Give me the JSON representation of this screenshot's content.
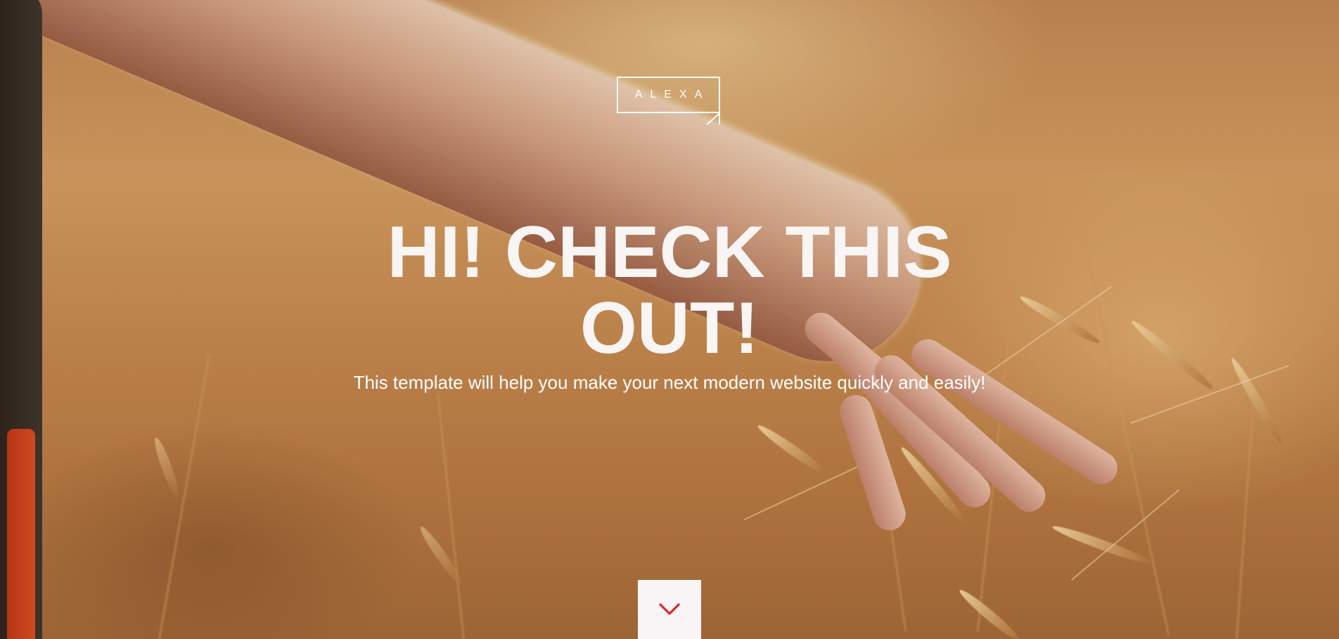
{
  "hero": {
    "logo_text": "ALEXA",
    "headline": "HI! CHECK THIS OUT!",
    "subtext": "This template will help you make your next modern website quickly and easily!",
    "scroll_icon": "chevron-down-icon"
  },
  "colors": {
    "text": "#ffffff",
    "scroll_button_bg": "#f9f4f6",
    "accent": "#e0262a"
  }
}
